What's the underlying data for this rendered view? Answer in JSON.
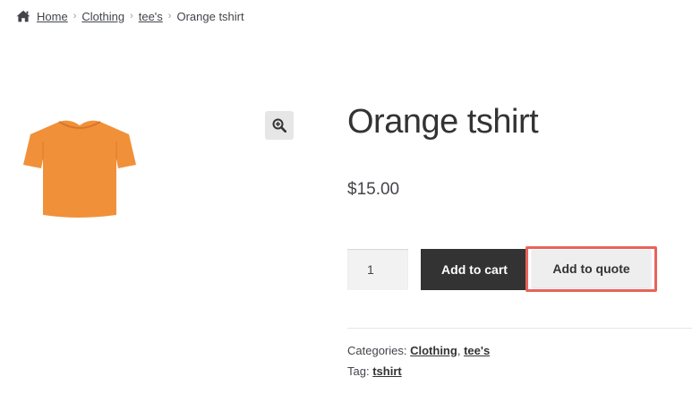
{
  "breadcrumb": {
    "icon": "home-icon",
    "items": [
      "Home",
      "Clothing",
      "tee's"
    ],
    "current": "Orange tshirt",
    "separator": "›"
  },
  "gallery": {
    "image": "orange-tshirt-image",
    "image_color": "#f0913a",
    "zoom_icon": "magnifier-zoom-icon"
  },
  "product": {
    "title": "Orange tshirt",
    "price": "$15.00",
    "quantity": "1",
    "add_to_cart_label": "Add to cart",
    "add_to_quote_label": "Add to quote",
    "highlight_color": "#e8635a"
  },
  "meta": {
    "categories_label": "Categories:",
    "categories": [
      "Clothing",
      "tee's"
    ],
    "categories_separator": ",",
    "tag_label": "Tag:",
    "tag": "tshirt"
  }
}
